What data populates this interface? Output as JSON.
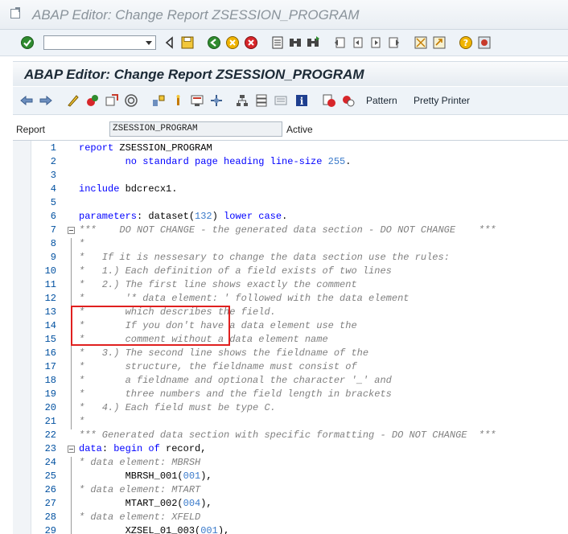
{
  "window": {
    "title": "ABAP Editor: Change Report ZSESSION_PROGRAM"
  },
  "system_toolbar": {
    "command_field_value": "",
    "icons": [
      "enter-icon",
      "back-icon",
      "save-icon",
      "exit-icon",
      "log-off-icon",
      "cancel-icon",
      "print-icon",
      "find-icon",
      "find-next-icon",
      "first-page-icon",
      "previous-page-icon",
      "next-page-icon",
      "last-page-icon",
      "new-session-icon",
      "shortcut-icon",
      "help-icon",
      "customize-icon"
    ]
  },
  "app": {
    "title": "ABAP Editor: Change Report ZSESSION_PROGRAM",
    "toolbar": {
      "pattern_label": "Pattern",
      "pretty_printer_label": "Pretty Printer"
    }
  },
  "report_field": {
    "label": "Report",
    "value": "ZSESSION_PROGRAM",
    "status": "Active"
  },
  "editor": {
    "lines": [
      {
        "n": "1",
        "parts": [
          [
            "kw",
            "report "
          ],
          [
            "tx",
            "ZSESSION_PROGRAM"
          ]
        ]
      },
      {
        "n": "2",
        "parts": [
          [
            "tx",
            "        "
          ],
          [
            "kw",
            "no standard page heading line-size "
          ],
          [
            "nu",
            "255"
          ],
          [
            "tx",
            "."
          ]
        ]
      },
      {
        "n": "3",
        "parts": []
      },
      {
        "n": "4",
        "parts": [
          [
            "kw",
            "include "
          ],
          [
            "tx",
            "bdcrecx1."
          ]
        ]
      },
      {
        "n": "5",
        "parts": []
      },
      {
        "n": "6",
        "parts": [
          [
            "kw",
            "parameters"
          ],
          [
            "tx",
            ": dataset("
          ],
          [
            "nu",
            "132"
          ],
          [
            "tx",
            ") "
          ],
          [
            "kw",
            "lower case"
          ],
          [
            "tx",
            "."
          ]
        ]
      },
      {
        "n": "7",
        "parts": [
          [
            "cm",
            "***    DO NOT CHANGE - the generated data section - DO NOT CHANGE    ***"
          ]
        ]
      },
      {
        "n": "8",
        "parts": [
          [
            "cm",
            "*"
          ]
        ]
      },
      {
        "n": "9",
        "parts": [
          [
            "cm",
            "*   If it is nessesary to change the data section use the rules:"
          ]
        ]
      },
      {
        "n": "10",
        "parts": [
          [
            "cm",
            "*   1.) Each definition of a field exists of two lines"
          ]
        ]
      },
      {
        "n": "11",
        "parts": [
          [
            "cm",
            "*   2.) The first line shows exactly the comment"
          ]
        ]
      },
      {
        "n": "12",
        "parts": [
          [
            "cm",
            "*       '* data element: ' followed with the data element"
          ]
        ]
      },
      {
        "n": "13",
        "parts": [
          [
            "cm",
            "*       which describes the field."
          ]
        ]
      },
      {
        "n": "14",
        "parts": [
          [
            "cm",
            "*       If you don't have a data element use the"
          ]
        ]
      },
      {
        "n": "15",
        "parts": [
          [
            "cm",
            "*       comment without a data element name"
          ]
        ]
      },
      {
        "n": "16",
        "parts": [
          [
            "cm",
            "*   3.) The second line shows the fieldname of the"
          ]
        ]
      },
      {
        "n": "17",
        "parts": [
          [
            "cm",
            "*       structure, the fieldname must consist of"
          ]
        ]
      },
      {
        "n": "18",
        "parts": [
          [
            "cm",
            "*       a fieldname and optional the character '_' and"
          ]
        ]
      },
      {
        "n": "19",
        "parts": [
          [
            "cm",
            "*       three numbers and the field length in brackets"
          ]
        ]
      },
      {
        "n": "20",
        "parts": [
          [
            "cm",
            "*   4.) Each field must be type C."
          ]
        ]
      },
      {
        "n": "21",
        "parts": [
          [
            "cm",
            "*"
          ]
        ]
      },
      {
        "n": "22",
        "parts": [
          [
            "cm",
            "*** Generated data section with specific formatting - DO NOT CHANGE  ***"
          ]
        ]
      },
      {
        "n": "23",
        "parts": [
          [
            "kw",
            "data"
          ],
          [
            "tx",
            ": "
          ],
          [
            "kw",
            "begin of "
          ],
          [
            "tx",
            "record,"
          ]
        ]
      },
      {
        "n": "24",
        "parts": [
          [
            "cm",
            "* data element: MBRSH"
          ]
        ]
      },
      {
        "n": "25",
        "parts": [
          [
            "tx",
            "        MBRSH_001("
          ],
          [
            "nu",
            "001"
          ],
          [
            "tx",
            "),"
          ]
        ]
      },
      {
        "n": "26",
        "parts": [
          [
            "cm",
            "* data element: MTART"
          ]
        ]
      },
      {
        "n": "27",
        "parts": [
          [
            "tx",
            "        MTART_002("
          ],
          [
            "nu",
            "004"
          ],
          [
            "tx",
            "),"
          ]
        ]
      },
      {
        "n": "28",
        "parts": [
          [
            "cm",
            "* data element: XFELD"
          ]
        ]
      },
      {
        "n": "29",
        "parts": [
          [
            "tx",
            "        XZSEL_01_003("
          ],
          [
            "nu",
            "001"
          ],
          [
            "tx",
            "),"
          ]
        ]
      }
    ]
  }
}
